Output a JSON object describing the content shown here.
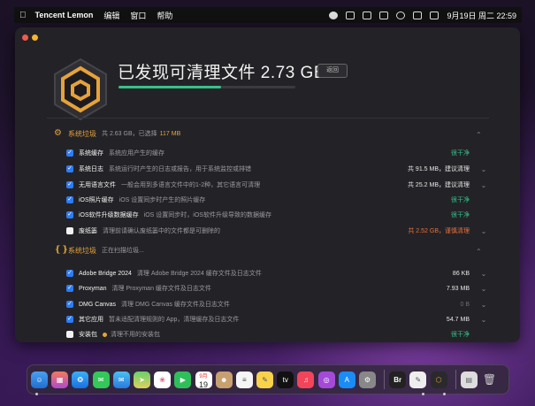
{
  "menubar": {
    "app_name": "Tencent Lemon",
    "menus": [
      "编辑",
      "窗口",
      "帮助"
    ],
    "date_time": "9月19日 周二  22:59"
  },
  "window": {
    "title": "已发现可清理文件 2.73 GB",
    "back_label": "返回",
    "progress": 0.58,
    "accent_green": "#35c28b",
    "accent_orange": "#e6a23a"
  },
  "sections": [
    {
      "title": "系统垃圾",
      "summary": "共 2.63 GB，已选择",
      "selected": "117 MB",
      "rows": [
        {
          "name": "系统缓存",
          "desc": "系统应用产生的缓存",
          "status": "很干净",
          "status_type": "green",
          "checked": true
        },
        {
          "name": "系统日志",
          "desc": "系统运行时产生的日志或报告，用于系统监控或排错",
          "status": "共 91.5 MB，建议清理",
          "status_type": "normal",
          "checked": true
        },
        {
          "name": "无用语言文件",
          "desc": "一般会用到多语言文件中的1-2种，其它语言可清理",
          "status": "共 25.2 MB，建议清理",
          "status_type": "normal",
          "checked": true
        },
        {
          "name": "iOS照片缓存",
          "desc": "iOS 设置同步时产生的照片缓存",
          "status": "很干净",
          "status_type": "green",
          "checked": true
        },
        {
          "name": "iOS软件升级数据缓存",
          "desc": "iOS 设置同步时，iOS软件升级导致的数据缓存",
          "status": "很干净",
          "status_type": "green",
          "checked": true
        },
        {
          "name": "废纸篓",
          "desc": "清理前请确认废纸篓中的文件都是可删除的",
          "status": "共 2.52 GB，谨慎清理",
          "status_type": "orange",
          "checked": false
        }
      ]
    },
    {
      "title": "系统垃圾",
      "summary": "正在扫描垃圾...",
      "selected": "",
      "rows": [
        {
          "name": "Adobe Bridge 2024",
          "desc": "清理 Adobe Bridge 2024 缓存文件及日志文件",
          "status": "86 KB",
          "status_type": "normal",
          "checked": true
        },
        {
          "name": "Proxyman",
          "desc": "清理 Proxyman 缓存文件及日志文件",
          "status": "7.93 MB",
          "status_type": "normal",
          "checked": true
        },
        {
          "name": "DMG Canvas",
          "desc": "清理 DMG Canvas 缓存文件及日志文件",
          "status": "0 B",
          "status_type": "gray",
          "checked": true
        },
        {
          "name": "其它应用",
          "desc": "暂未适配清理规则的 App，清理缓存及日志文件",
          "status": "54.7 MB",
          "status_type": "normal",
          "checked": true
        },
        {
          "name": "安装包",
          "desc": "清理不用的安装包",
          "status": "很干净",
          "status_type": "green",
          "checked": false
        }
      ]
    }
  ],
  "dock": {
    "calendar_month": "9月",
    "calendar_day": "19",
    "tv_label": "tv",
    "bridge_label": "Br"
  }
}
